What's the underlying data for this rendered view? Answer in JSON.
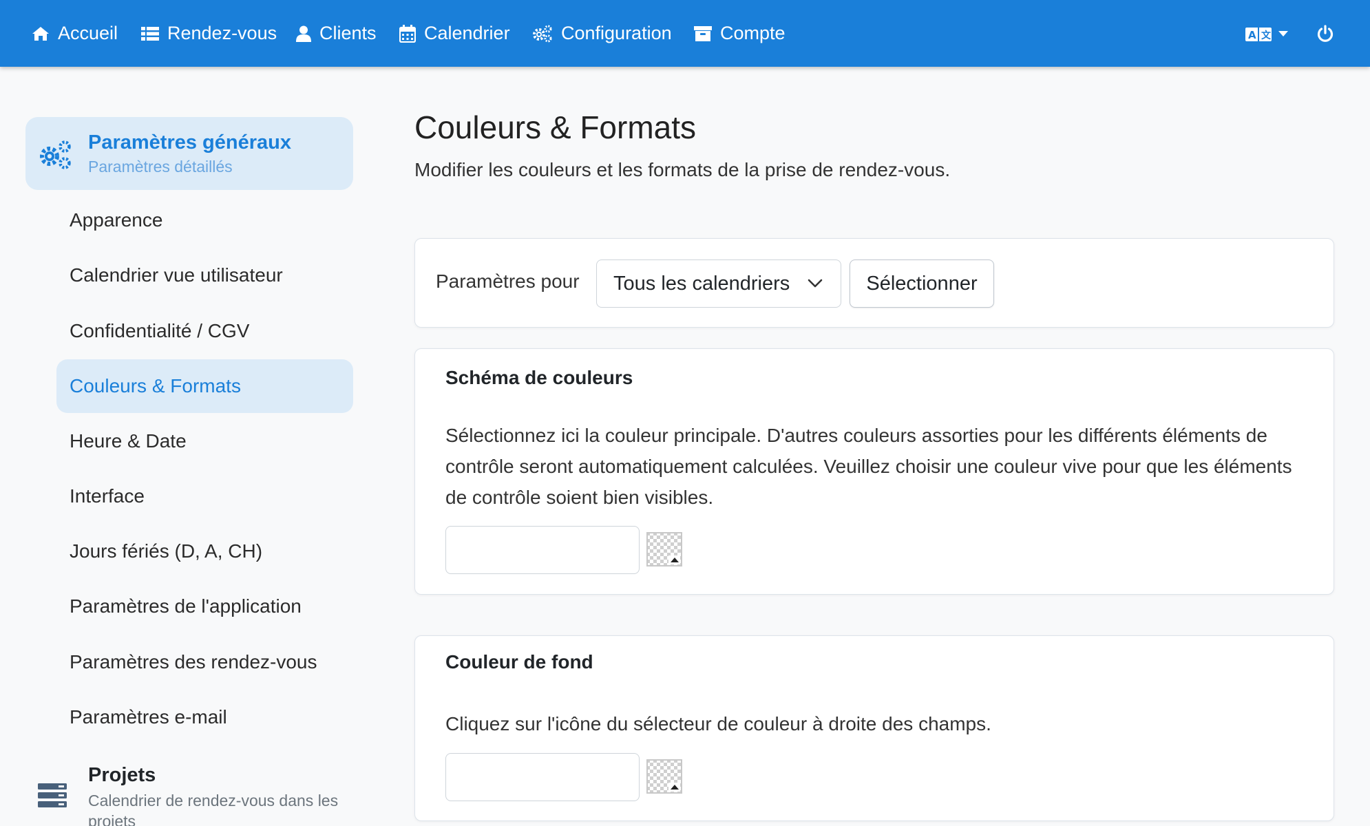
{
  "navbar": {
    "items": [
      {
        "label": "Accueil",
        "icon": "home-icon"
      },
      {
        "label": "Rendez-vous",
        "icon": "list-icon"
      },
      {
        "label": "Clients",
        "icon": "user-icon"
      },
      {
        "label": "Calendrier",
        "icon": "calendar-icon"
      },
      {
        "label": "Configuration",
        "icon": "cogs-icon"
      },
      {
        "label": "Compte",
        "icon": "archive-icon"
      }
    ],
    "right": {
      "language_icon": "language-icon",
      "power_icon": "power-icon"
    }
  },
  "sidebar": {
    "group": {
      "title": "Paramètres généraux",
      "subtitle": "Paramètres détaillés",
      "icon": "cogs-icon"
    },
    "items": [
      {
        "label": "Apparence",
        "active": false
      },
      {
        "label": "Calendrier vue utilisateur",
        "active": false
      },
      {
        "label": "Confidentialité / CGV",
        "active": false
      },
      {
        "label": "Couleurs & Formats",
        "active": true
      },
      {
        "label": "Heure & Date",
        "active": false
      },
      {
        "label": "Interface",
        "active": false
      },
      {
        "label": "Jours fériés (D, A, CH)",
        "active": false
      },
      {
        "label": "Paramètres de l'application",
        "active": false
      },
      {
        "label": "Paramètres des rendez-vous",
        "active": false
      },
      {
        "label": "Paramètres e-mail",
        "active": false
      }
    ],
    "group2": {
      "title": "Projets",
      "subtitle": "Calendrier de rendez-vous dans les projets",
      "icon": "server-icon"
    }
  },
  "main": {
    "title": "Couleurs & Formats",
    "subtitle": "Modifier les couleurs et les formats de la prise de rendez-vous.",
    "filter": {
      "label": "Paramètres pour",
      "selected": "Tous les calendriers",
      "button": "Sélectionner"
    },
    "scheme": {
      "title": "Schéma de couleurs",
      "text": "Sélectionnez ici la couleur principale. D'autres couleurs assorties pour les différents éléments de contrôle seront automatiquement calculées. Veuillez choisir une couleur vive pour que les éléments de contrôle soient bien visibles.",
      "value": ""
    },
    "background": {
      "title": "Couleur de fond",
      "text": "Cliquez sur l'icône du sélecteur de couleur à droite des champs.",
      "value": ""
    }
  },
  "colors": {
    "primary": "#1a7fd9",
    "active_bg": "#dcebf8",
    "page_bg": "#f8f9fa"
  }
}
